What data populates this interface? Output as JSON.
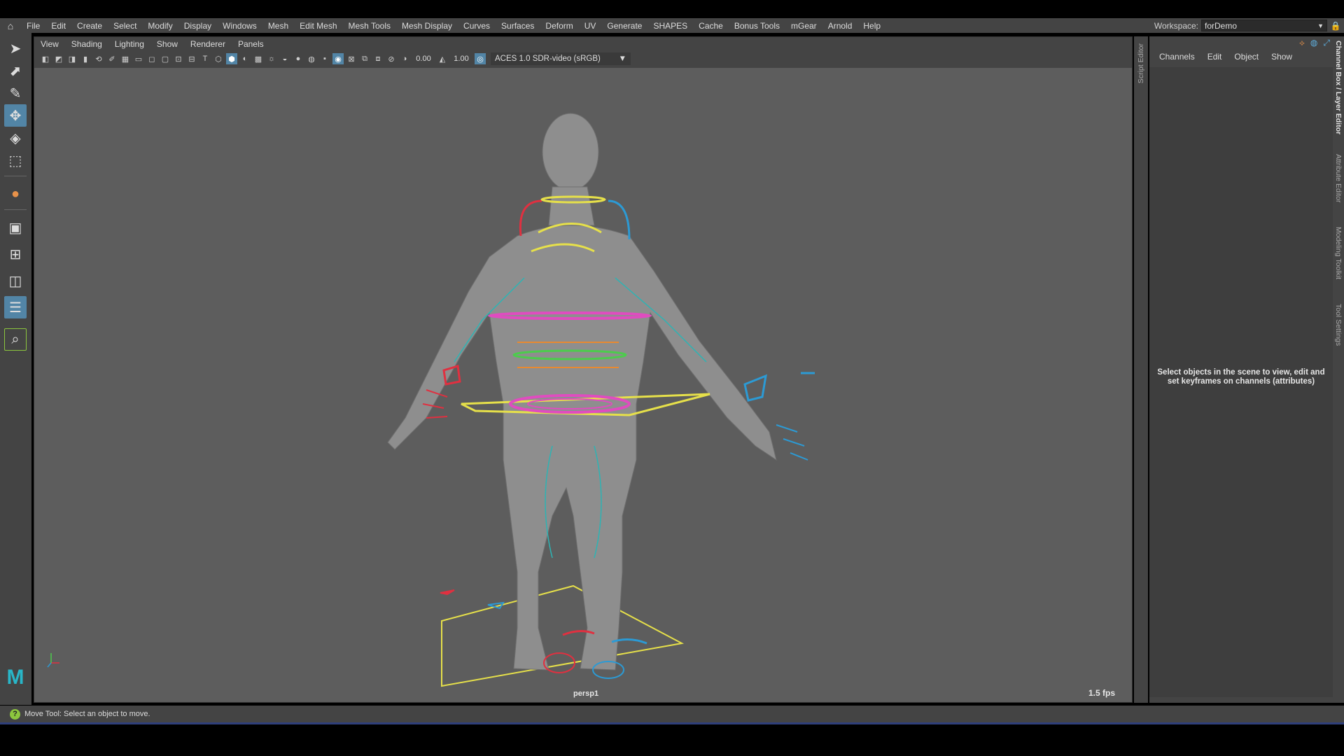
{
  "menubar": {
    "home_icon": "home-icon",
    "items": [
      "File",
      "Edit",
      "Create",
      "Select",
      "Modify",
      "Display",
      "Windows",
      "Mesh",
      "Edit Mesh",
      "Mesh Tools",
      "Mesh Display",
      "Curves",
      "Surfaces",
      "Deform",
      "UV",
      "Generate",
      "SHAPES",
      "Cache",
      "Bonus Tools",
      "mGear",
      "Arnold",
      "Help"
    ],
    "workspace_label": "Workspace:",
    "workspace_value": "forDemo"
  },
  "panel": {
    "menu": [
      "View",
      "Shading",
      "Lighting",
      "Show",
      "Renderer",
      "Panels"
    ],
    "exposure": "0.00",
    "gamma": "1.00",
    "color_management": "ACES 1.0 SDR-video (sRGB)"
  },
  "viewport": {
    "camera": "persp1",
    "fps": "1.5 fps"
  },
  "side": {
    "script_editor": "Script Editor",
    "tabs": [
      "Channel Box / Layer Editor",
      "Attribute Editor",
      "Modeling Toolkit",
      "Tool Settings"
    ]
  },
  "channel_box": {
    "menu": [
      "Channels",
      "Edit",
      "Object",
      "Show"
    ],
    "empty_message": "Select objects in the scene to view, edit and set keyframes on channels (attributes)"
  },
  "status": {
    "help_line": "Move Tool: Select an object to move."
  },
  "colors": {
    "accent": "#5285a6",
    "viewport_bg": "#5d5d5d",
    "maya_logo": "#29b6c8"
  }
}
